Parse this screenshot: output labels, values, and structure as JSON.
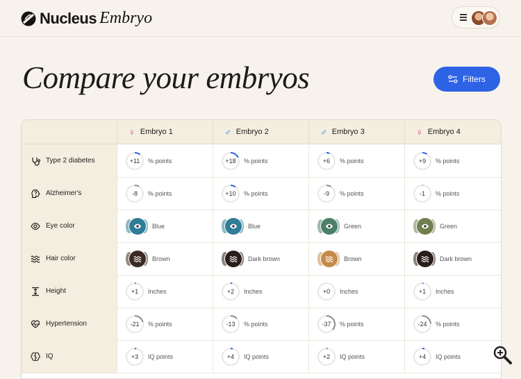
{
  "brand": {
    "name": "Nucleus",
    "sub": "Embryo"
  },
  "page": {
    "title": "Compare your embryos",
    "filters_label": "Filters"
  },
  "columns": [
    {
      "name": "Embryo 1",
      "gender": "♀",
      "color": "#d83c8e"
    },
    {
      "name": "Embryo 2",
      "gender": "♂",
      "color": "#2a7fd1"
    },
    {
      "name": "Embryo 3",
      "gender": "♂",
      "color": "#2a7fd1"
    },
    {
      "name": "Embryo 4",
      "gender": "♀",
      "color": "#d83c8e"
    }
  ],
  "rows": [
    {
      "label": "Type 2 diabetes",
      "icon": "stethoscope-icon",
      "kind": "ring",
      "unit": "% points",
      "values": [
        "+11",
        "+18",
        "+6",
        "+9"
      ],
      "pct": [
        11,
        18,
        6,
        9
      ],
      "ring_color": "#2e63e6"
    },
    {
      "label": "Alzheimer's",
      "icon": "brain-question-icon",
      "kind": "ring",
      "unit": "% points",
      "values": [
        "-8",
        "+10",
        "-9",
        "-1"
      ],
      "pct": [
        8,
        10,
        9,
        1
      ],
      "ring_colors": [
        "#8a8a8a",
        "#2e63e6",
        "#8a8a8a",
        "#8a8a8a"
      ]
    },
    {
      "label": "Eye color",
      "icon": "eye-icon",
      "kind": "swatch",
      "values": [
        "Blue",
        "Blue",
        "Green",
        "Green"
      ],
      "swatch_colors": [
        "#2f7d96",
        "#2f7d96",
        "#4d7f6a",
        "#6f7f4e"
      ]
    },
    {
      "label": "Hair color",
      "icon": "waves-icon",
      "kind": "swatch",
      "values": [
        "Brown",
        "Dark brown",
        "Brown",
        "Dark brown"
      ],
      "swatch_colors": [
        "#3a2a22",
        "#2b1d18",
        "#c58a4a",
        "#2b1d18"
      ]
    },
    {
      "label": "Height",
      "icon": "height-icon",
      "kind": "ring",
      "unit": "Inches",
      "values": [
        "+1",
        "+2",
        "+0",
        "+1"
      ],
      "pct": [
        2,
        3,
        0,
        2
      ],
      "ring_color": "#2e63e6"
    },
    {
      "label": "Hypertension",
      "icon": "heart-pulse-icon",
      "kind": "ring",
      "unit": "% points",
      "values": [
        "-21",
        "-13",
        "-37",
        "-24"
      ],
      "pct": [
        21,
        13,
        37,
        24
      ],
      "ring_color": "#8a8a8a"
    },
    {
      "label": "IQ",
      "icon": "brain-icon",
      "kind": "ring",
      "unit": "IQ points",
      "values": [
        "+3",
        "+4",
        "+2",
        "+4"
      ],
      "pct": [
        3,
        4,
        2,
        4
      ],
      "ring_color": "#2e63e6"
    }
  ]
}
